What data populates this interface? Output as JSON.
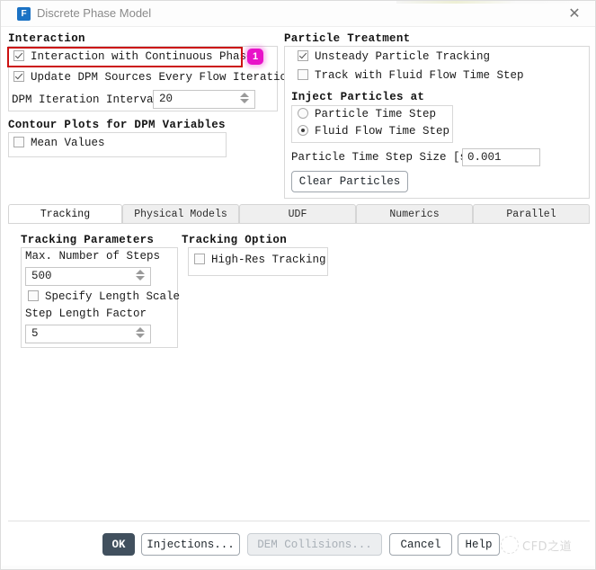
{
  "window": {
    "title": "Discrete Phase Model",
    "icon": "fluent-app-icon",
    "icon_letter": "F",
    "close_label": "✕"
  },
  "interaction": {
    "heading": "Interaction",
    "checkbox_interaction_continuous_phase": {
      "label": "Interaction with Continuous Phase",
      "checked": true
    },
    "checkbox_update_dpm_sources": {
      "label": "Update DPM Sources Every Flow Iteration",
      "checked": true
    },
    "dpm_iteration_interval": {
      "label": "DPM Iteration Interval",
      "value": "20"
    }
  },
  "contour_plots": {
    "heading": "Contour Plots for DPM Variables",
    "checkbox_mean_values": {
      "label": "Mean Values",
      "checked": false
    }
  },
  "particle_treatment": {
    "heading": "Particle Treatment",
    "checkbox_unsteady_particle_tracking": {
      "label": "Unsteady Particle Tracking",
      "checked": true
    },
    "checkbox_track_with_fluid_flow_time_step": {
      "label": "Track with Fluid Flow Time Step",
      "checked": false
    },
    "inject_particles_at": {
      "heading": "Inject Particles at",
      "options": [
        {
          "label": "Particle Time Step",
          "selected": false
        },
        {
          "label": "Fluid Flow Time Step",
          "selected": true
        }
      ]
    },
    "particle_time_step_size": {
      "label": "Particle Time Step Size [s]",
      "value": "0.001"
    },
    "clear_particles_button": "Clear Particles"
  },
  "tabs": [
    {
      "label": "Tracking",
      "active": true
    },
    {
      "label": "Physical Models",
      "active": false
    },
    {
      "label": "UDF",
      "active": false
    },
    {
      "label": "Numerics",
      "active": false
    },
    {
      "label": "Parallel",
      "active": false
    }
  ],
  "tracking_parameters": {
    "heading": "Tracking Parameters",
    "max_number_of_steps": {
      "label": "Max. Number of Steps",
      "value": "500"
    },
    "checkbox_specify_length_scale": {
      "label": "Specify Length Scale",
      "checked": false
    },
    "step_length_factor": {
      "label": "Step Length Factor",
      "value": "5"
    }
  },
  "tracking_option": {
    "heading": "Tracking Option",
    "checkbox_high_res_tracking": {
      "label": "High-Res Tracking",
      "checked": false
    }
  },
  "footer_buttons": [
    {
      "label": "OK",
      "style": "primary"
    },
    {
      "label": "Injections...",
      "style": "normal"
    },
    {
      "label": "DEM Collisions...",
      "style": "disabled"
    },
    {
      "label": "Cancel",
      "style": "normal"
    },
    {
      "label": "Help",
      "style": "normal"
    }
  ],
  "annotations": {
    "step_badge_1": "1",
    "highlight_color": "#cc1111",
    "badge_color": "#e812c8"
  },
  "watermark": {
    "text": "CFD之道"
  }
}
